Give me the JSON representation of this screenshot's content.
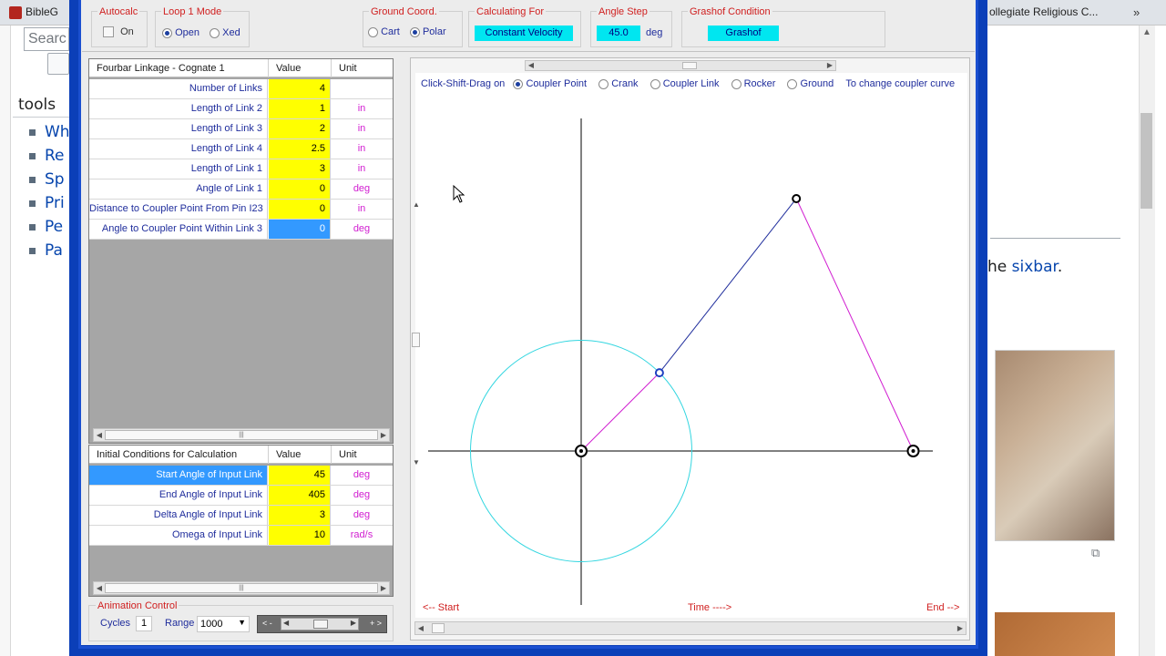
{
  "background_browser": {
    "tabs": [
      {
        "label": "BibleG"
      },
      {
        "label": "ollegiate Religious C..."
      }
    ],
    "overflow_chevrons": "»",
    "search_placeholder": "Searc",
    "tools_title": "tools",
    "tools_items": [
      "Wh",
      "Re",
      "Sp",
      "Pri",
      "Pe",
      "Pa"
    ],
    "text_prefix": "he ",
    "text_link": "sixbar",
    "text_suffix": "."
  },
  "toolbar": {
    "autocalc": {
      "title": "Autocalc",
      "on_label": "On",
      "checked": false
    },
    "loop_mode": {
      "title": "Loop 1 Mode",
      "options": [
        {
          "label": "Open",
          "selected": true
        },
        {
          "label": "Xed",
          "selected": false
        }
      ]
    },
    "ground_coord": {
      "title": "Ground Coord.",
      "options": [
        {
          "label": "Cart",
          "selected": false
        },
        {
          "label": "Polar",
          "selected": true
        }
      ]
    },
    "calculating_for": {
      "title": "Calculating For",
      "value": "Constant Velocity"
    },
    "angle_step": {
      "title": "Angle Step",
      "value": "45.0",
      "unit": "deg"
    },
    "grashof": {
      "title": "Grashof Condition",
      "value": "Grashof"
    }
  },
  "linkage_table": {
    "headers": [
      "Fourbar Linkage - Cognate 1",
      "Value",
      "Unit"
    ],
    "rows": [
      {
        "name": "Number of Links",
        "value": "4",
        "unit": ""
      },
      {
        "name": "Length of Link 2",
        "value": "1",
        "unit": "in"
      },
      {
        "name": "Length of Link 3",
        "value": "2",
        "unit": "in"
      },
      {
        "name": "Length of Link 4",
        "value": "2.5",
        "unit": "in"
      },
      {
        "name": "Length of Link 1",
        "value": "3",
        "unit": "in"
      },
      {
        "name": "Angle of Link 1",
        "value": "0",
        "unit": "deg"
      },
      {
        "name": "Distance to Coupler Point From Pin I23",
        "value": "0",
        "unit": "in"
      },
      {
        "name": "Angle to Coupler Point Within Link 3",
        "value": "0",
        "unit": "deg",
        "selected": true
      }
    ]
  },
  "initial_conditions_table": {
    "headers": [
      "Initial Conditions for Calculation",
      "Value",
      "Unit"
    ],
    "rows": [
      {
        "name": "Start Angle of Input Link",
        "value": "45",
        "unit": "deg",
        "name_selected": true
      },
      {
        "name": "End Angle of Input Link",
        "value": "405",
        "unit": "deg"
      },
      {
        "name": "Delta Angle of Input Link",
        "value": "3",
        "unit": "deg"
      },
      {
        "name": "Omega of Input Link",
        "value": "10",
        "unit": "rad/s"
      }
    ]
  },
  "animation_control": {
    "title": "Animation Control",
    "cycles_label": "Cycles",
    "cycles_value": "1",
    "range_label": "Range",
    "range_value": "1000",
    "slider_left": "< -",
    "slider_right": "+ >"
  },
  "plot": {
    "drag_label": "Click-Shift-Drag on",
    "drag_options": [
      {
        "label": "Coupler Point",
        "selected": true
      },
      {
        "label": "Crank",
        "selected": false
      },
      {
        "label": "Coupler Link",
        "selected": false
      },
      {
        "label": "Rocker",
        "selected": false
      },
      {
        "label": "Ground",
        "selected": false
      }
    ],
    "drag_hint": "To change coupler curve",
    "footer_start": "<-- Start",
    "footer_time": "Time ---->",
    "footer_end": "End -->",
    "colors": {
      "crank": "#d11ed1",
      "coupler": "#1f2d9c",
      "rocker": "#d11ed1",
      "coupler_curve": "#33d6e0",
      "axes": "#000000"
    }
  },
  "mechanism": {
    "unit": "in",
    "ground_pivot_o2": [
      0,
      0
    ],
    "ground_pivot_o4": [
      3,
      0
    ],
    "crank_pin_a": [
      0.707,
      0.707
    ],
    "coupler_point_b": [
      1.944,
      2.28
    ],
    "crank_circle_radius": 1
  }
}
